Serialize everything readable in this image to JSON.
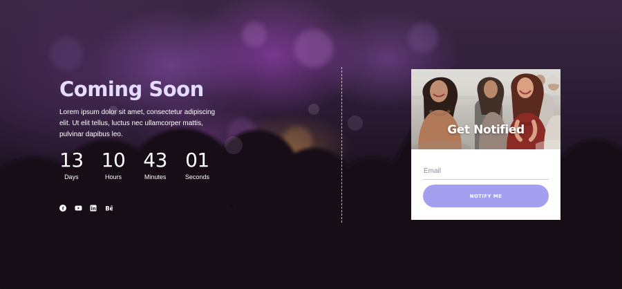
{
  "hero": {
    "title": "Coming Soon",
    "description": "Lorem ipsum dolor sit amet, consectetur adipiscing elit. Ut elit tellus, luctus nec ullamcorper mattis, pulvinar dapibus leo."
  },
  "countdown": [
    {
      "value": "13",
      "label": "Days"
    },
    {
      "value": "10",
      "label": "Hours"
    },
    {
      "value": "43",
      "label": "Minutes"
    },
    {
      "value": "01",
      "label": "Seconds"
    }
  ],
  "socials": [
    {
      "icon": "facebook-icon"
    },
    {
      "icon": "youtube-icon"
    },
    {
      "icon": "linkedin-icon"
    },
    {
      "icon": "behance-icon"
    }
  ],
  "signup": {
    "heading": "Get Notified",
    "email_placeholder": "Email",
    "email_value": "",
    "button_label": "NOTIFY ME"
  },
  "colors": {
    "title": "#e4dbff",
    "button": "#a4a0ef",
    "card_background": "#ffffff"
  }
}
